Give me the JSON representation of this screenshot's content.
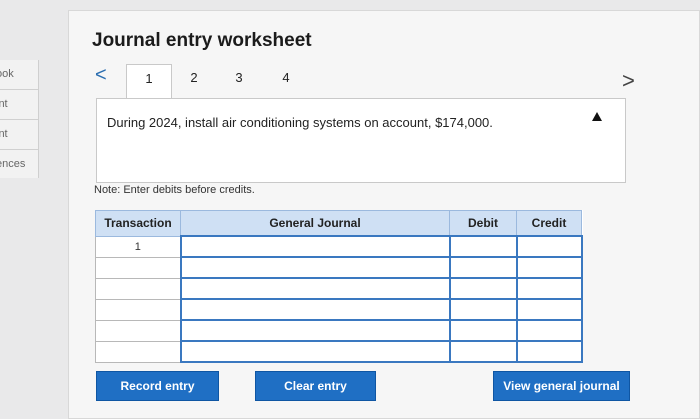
{
  "sidebar": {
    "items": [
      {
        "label": "ook"
      },
      {
        "label": "int"
      },
      {
        "label": "int"
      },
      {
        "label": "ences"
      }
    ]
  },
  "worksheet": {
    "title": "Journal entry worksheet",
    "nav_prev": "<",
    "nav_next": ">",
    "tabs": [
      {
        "label": "1",
        "active": true
      },
      {
        "label": "2",
        "active": false
      },
      {
        "label": "3",
        "active": false
      },
      {
        "label": "4",
        "active": false
      }
    ],
    "description": "During 2024, install air conditioning systems on account, $174,000.",
    "note": "Note: Enter debits before credits."
  },
  "table": {
    "headers": {
      "transaction": "Transaction",
      "general_journal": "General Journal",
      "debit": "Debit",
      "credit": "Credit"
    },
    "rows": [
      {
        "transaction": "1",
        "account": "",
        "debit": "",
        "credit": ""
      },
      {
        "transaction": "",
        "account": "",
        "debit": "",
        "credit": ""
      },
      {
        "transaction": "",
        "account": "",
        "debit": "",
        "credit": ""
      },
      {
        "transaction": "",
        "account": "",
        "debit": "",
        "credit": ""
      },
      {
        "transaction": "",
        "account": "",
        "debit": "",
        "credit": ""
      },
      {
        "transaction": "",
        "account": "",
        "debit": "",
        "credit": ""
      }
    ]
  },
  "buttons": {
    "record": "Record entry",
    "clear": "Clear entry",
    "view": "View general journal"
  }
}
